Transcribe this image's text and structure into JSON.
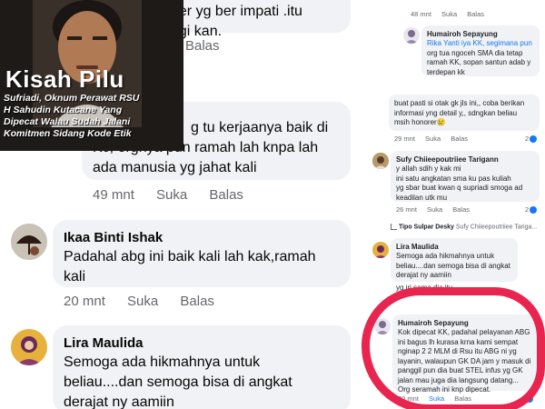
{
  "thumbnail": {
    "title": "Kisah Pilu",
    "subtitle_lines": [
      "Sufriadi, Oknum Perawat RSU",
      "H Sahudin Kutacane Yang",
      "Dipecat Walau Sudah Jalani",
      "Komitmen Sidang Kode Etik"
    ]
  },
  "left": {
    "comment0": {
      "text_lines": [
        "aer yg ber impati .itu",
        "agi kan."
      ],
      "meta": {
        "like": "Balas"
      }
    },
    "comment1": {
      "text_lines": [
        "g tu kerjaanya baik di",
        "Kc, orgnya pun ramah lah knpa lah",
        "ada manusia yg jahat kali"
      ],
      "meta": {
        "time": "49 mnt",
        "like": "Suka",
        "reply": "Balas"
      }
    },
    "comment2": {
      "name": "Ikaa Binti Ishak",
      "text_lines": [
        "Padahal abg ini baik kali lah kak,ramah",
        "kali"
      ],
      "meta": {
        "time": "20 mnt",
        "like": "Suka",
        "reply": "Balas"
      }
    },
    "comment3": {
      "name": "Lira Maulida",
      "text_lines": [
        "Semoga ada hikmahnya untuk",
        "beliau....dan semoga bisa di angkat",
        "derajat ny aamiin"
      ]
    }
  },
  "right": {
    "top_meta": {
      "time": "48 mnt",
      "like": "Suka",
      "reply": "Balas"
    },
    "c1": {
      "name": "Humairoh Sepayung",
      "mention": "Rika Yanti",
      "text_lines": [
        "Rika Yanti iya KK,  segimana pun",
        "org tua ngoceh SMA dia tetap",
        "ramah KK, sopan santun adab y",
        "terdepan kk"
      ]
    },
    "c2": {
      "text_lines": [
        "buat pasti si otak gk jls ini,, coba berikan",
        "informasi yng detail y,, sdngkan beliau",
        "msih honorer😢"
      ],
      "meta": {
        "time": "29 mnt",
        "like": "Suka",
        "reply": "Balas"
      },
      "reactions": "2"
    },
    "c3": {
      "name": "Sufy Chiieepoutriiee Tarigann",
      "text_lines": [
        "y allah sdih y kak mi",
        "ini satu angkatan sma ku pas kuliah",
        "yg sbar buat kwan q supriadi smoga ad",
        "keadilan utk mu"
      ],
      "meta": {
        "time": "26 mnt",
        "like": "Suka",
        "reply": "Balas"
      },
      "reactions": "2"
    },
    "c3_reply": {
      "name": "Tipo Sulpar Desky",
      "text": "Sufy Chiieepoutriiee Tariga..."
    },
    "c4": {
      "name": "Lira Maulida",
      "text_lines": [
        "Semoga ada hikmahnya untuk",
        "beliau....dan semoga bisa di angkat",
        "derajat ny aamiin"
      ],
      "extra": "yg iri sama dia itu"
    },
    "c5": {
      "name": "Humairoh Sepayung",
      "text_lines": [
        "Kok dipecat KK, padahal pelayanan ABG",
        "ini bagus lh kurasa krna kami sempat",
        "nginap 2 2 MLM di Rsu itu ABG ni yg",
        "layanin, walaupun GK DA jam y masuk di",
        "panggil pun dia buat STEL infus yg GK",
        "jalan mau juga dia langsung datang...",
        "Org seramah ini knp dipecat."
      ],
      "meta": {
        "time": "20 mnt",
        "like": "Suka",
        "reply": "Balas"
      },
      "reactions": "2"
    }
  },
  "colors": {
    "bubble": "#f0f2f5",
    "meta": "#65676b",
    "mention": "#1877f2",
    "highlight_ring": "#e8244f"
  }
}
